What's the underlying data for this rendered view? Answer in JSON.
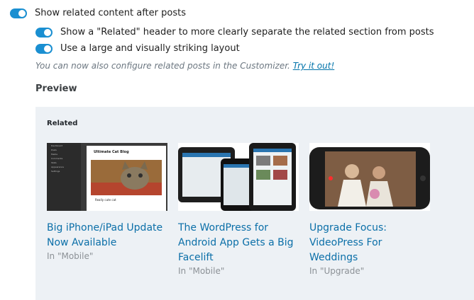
{
  "options": {
    "show_related": "Show related content after posts",
    "show_header": "Show a \"Related\" header to more clearly separate the related section from posts",
    "large_layout": "Use a large and visually striking layout"
  },
  "note": {
    "text": "You can now also configure related posts in the Customizer.",
    "link": "Try it out!"
  },
  "preview": {
    "title": "Preview",
    "related_label": "Related",
    "thumb1": {
      "app_title": "Ultimate Cat Blog",
      "caption": "Really cute cat",
      "sidebar": [
        "Dashboard",
        "Posts",
        "Media",
        "Comments",
        "Stats",
        "Appearance",
        "Settings"
      ]
    },
    "posts": [
      {
        "title": "Big iPhone/iPad Update Now Available",
        "category": "In \"Mobile\""
      },
      {
        "title": "The WordPress for Android App Gets a Big Facelift",
        "category": "In \"Mobile\""
      },
      {
        "title": "Upgrade Focus: VideoPress For Weddings",
        "category": "In \"Upgrade\""
      }
    ]
  },
  "colors": {
    "toggle_on": "#1a8fd1",
    "link": "#0b6fa8",
    "panel_bg": "#edf1f5"
  }
}
